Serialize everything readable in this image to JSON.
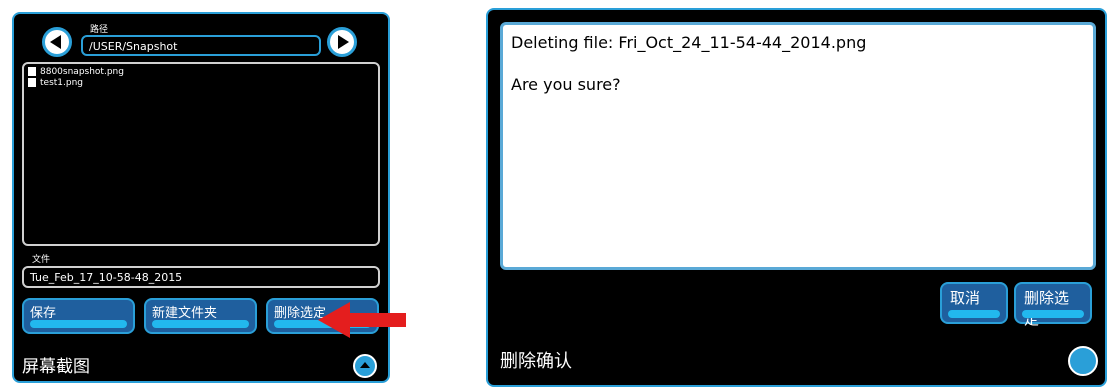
{
  "file_browser": {
    "path_label": "路径",
    "path_value": "/USER/Snapshot",
    "files": [
      "8800snapshot.png",
      "test1.png"
    ],
    "file_label": "文件",
    "file_value": "Tue_Feb_17_10-58-48_2015",
    "buttons": {
      "save": "保存",
      "new_folder": "新建文件夹",
      "delete_selected": "删除选定"
    },
    "title": "屏幕截图"
  },
  "confirm_dialog": {
    "message_line1": "Deleting file: Fri_Oct_24_11-54-44_2014.png",
    "message_line2": "Are you sure?",
    "buttons": {
      "cancel": "取消",
      "delete_selected": "删除选定"
    },
    "title": "删除确认"
  },
  "colors": {
    "accent": "#2a9fd8",
    "button_fill": "#1f5f9e",
    "button_bar": "#22b8ee",
    "annotation_arrow": "#e41e1e"
  },
  "icons": {
    "back": "left-arrow-circle-icon",
    "forward": "right-arrow-circle-icon",
    "file": "file-icon",
    "menu": "eject-up-icon"
  }
}
